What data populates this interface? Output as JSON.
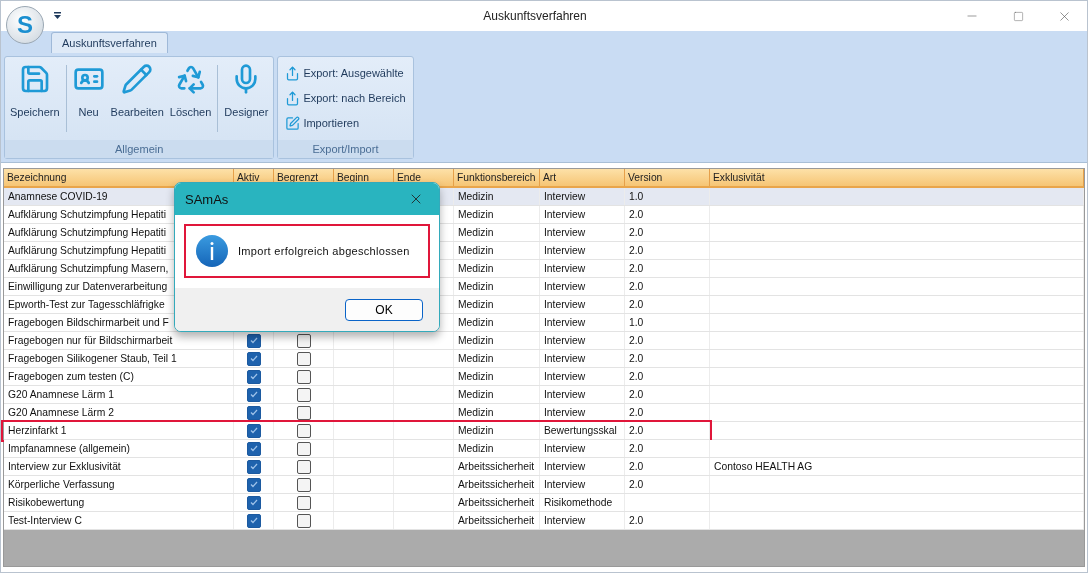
{
  "window": {
    "title": "Auskunftsverfahren",
    "logo_letter": "S"
  },
  "ribbon": {
    "tabs": [
      {
        "label": "Auskunftsverfahren",
        "selected": true
      }
    ],
    "groups": [
      {
        "label": "Allgemein",
        "kind": "large",
        "buttons": [
          {
            "label": "Speichern"
          },
          {
            "label": "Neu"
          },
          {
            "label": "Bearbeiten"
          },
          {
            "label": "Löschen"
          },
          {
            "label": "Designer"
          }
        ]
      },
      {
        "label": "Export/Import",
        "kind": "small",
        "buttons": [
          {
            "label": "Export: Ausgewählte"
          },
          {
            "label": "Export: nach Bereich"
          },
          {
            "label": "Importieren"
          }
        ]
      }
    ]
  },
  "table": {
    "columns": [
      "Bezeichnung",
      "Aktiv",
      "Begrenzt",
      "Beginn",
      "Ende",
      "Funktionsbereich",
      "Art",
      "Version",
      "Exklusivität"
    ],
    "rows": [
      {
        "name": "Anamnese COVID-19",
        "bereich": "Medizin",
        "art": "Interview",
        "version": "1.0",
        "selected": true,
        "highlighted": false
      },
      {
        "name": "Aufklärung Schutzimpfung Hepatiti",
        "bereich": "Medizin",
        "art": "Interview",
        "version": "2.0",
        "selected": false,
        "highlighted": false
      },
      {
        "name": "Aufklärung Schutzimpfung Hepatiti",
        "bereich": "Medizin",
        "art": "Interview",
        "version": "2.0",
        "selected": false,
        "highlighted": false
      },
      {
        "name": "Aufklärung Schutzimpfung Hepatiti",
        "bereich": "Medizin",
        "art": "Interview",
        "version": "2.0",
        "selected": false,
        "highlighted": false
      },
      {
        "name": "Aufklärung Schutzimpfung Masern,",
        "bereich": "Medizin",
        "art": "Interview",
        "version": "2.0",
        "selected": false,
        "highlighted": false
      },
      {
        "name": "Einwilligung zur Datenverarbeitung",
        "bereich": "Medizin",
        "art": "Interview",
        "version": "2.0",
        "selected": false,
        "highlighted": false
      },
      {
        "name": "Epworth-Test zur Tagesschläfrigke",
        "bereich": "Medizin",
        "art": "Interview",
        "version": "2.0",
        "selected": false,
        "highlighted": false
      },
      {
        "name": "Fragebogen Bildschirmarbeit und F",
        "bereich": "Medizin",
        "art": "Interview",
        "version": "1.0",
        "selected": false,
        "highlighted": false
      },
      {
        "name": "Fragebogen nur für Bildschirmarbeit",
        "aktiv": true,
        "begrenzt": false,
        "bereich": "Medizin",
        "art": "Interview",
        "version": "2.0",
        "selected": false,
        "highlighted": false
      },
      {
        "name": "Fragebogen Silikogener Staub, Teil 1",
        "aktiv": true,
        "begrenzt": false,
        "bereich": "Medizin",
        "art": "Interview",
        "version": "2.0",
        "selected": false,
        "highlighted": false
      },
      {
        "name": "Fragebogen zum testen (C)",
        "aktiv": true,
        "begrenzt": false,
        "bereich": "Medizin",
        "art": "Interview",
        "version": "2.0",
        "selected": false,
        "highlighted": false
      },
      {
        "name": "G20 Anamnese Lärm 1",
        "aktiv": true,
        "begrenzt": false,
        "bereich": "Medizin",
        "art": "Interview",
        "version": "2.0",
        "selected": false,
        "highlighted": false
      },
      {
        "name": "G20 Anamnese Lärm 2",
        "aktiv": true,
        "begrenzt": false,
        "bereich": "Medizin",
        "art": "Interview",
        "version": "2.0",
        "selected": false,
        "highlighted": false
      },
      {
        "name": "Herzinfarkt 1",
        "aktiv": true,
        "begrenzt": false,
        "bereich": "Medizin",
        "art": "Bewertungsskal",
        "version": "2.0",
        "selected": false,
        "highlighted": true
      },
      {
        "name": "Impfanamnese (allgemein)",
        "aktiv": true,
        "begrenzt": false,
        "bereich": "Medizin",
        "art": "Interview",
        "version": "2.0",
        "selected": false,
        "highlighted": false
      },
      {
        "name": "Interview zur Exklusivität",
        "aktiv": true,
        "begrenzt": false,
        "bereich": "Arbeitssicherheit",
        "art": "Interview",
        "version": "2.0",
        "exklusiv": "Contoso HEALTH AG",
        "selected": false,
        "highlighted": false
      },
      {
        "name": "Körperliche Verfassung",
        "aktiv": true,
        "begrenzt": false,
        "bereich": "Arbeitssicherheit",
        "art": "Interview",
        "version": "2.0",
        "selected": false,
        "highlighted": false
      },
      {
        "name": "Risikobewertung",
        "aktiv": true,
        "begrenzt": false,
        "bereich": "Arbeitssicherheit",
        "art": "Risikomethode",
        "selected": false,
        "highlighted": false
      },
      {
        "name": "Test-Interview C",
        "aktiv": true,
        "begrenzt": false,
        "bereich": "Arbeitssicherheit",
        "art": "Interview",
        "version": "2.0",
        "selected": false,
        "highlighted": false
      }
    ]
  },
  "dialog": {
    "title": "SAmAs",
    "message": "Import erfolgreich abgeschlossen",
    "message_highlighted": true,
    "buttons": [
      "OK"
    ]
  }
}
